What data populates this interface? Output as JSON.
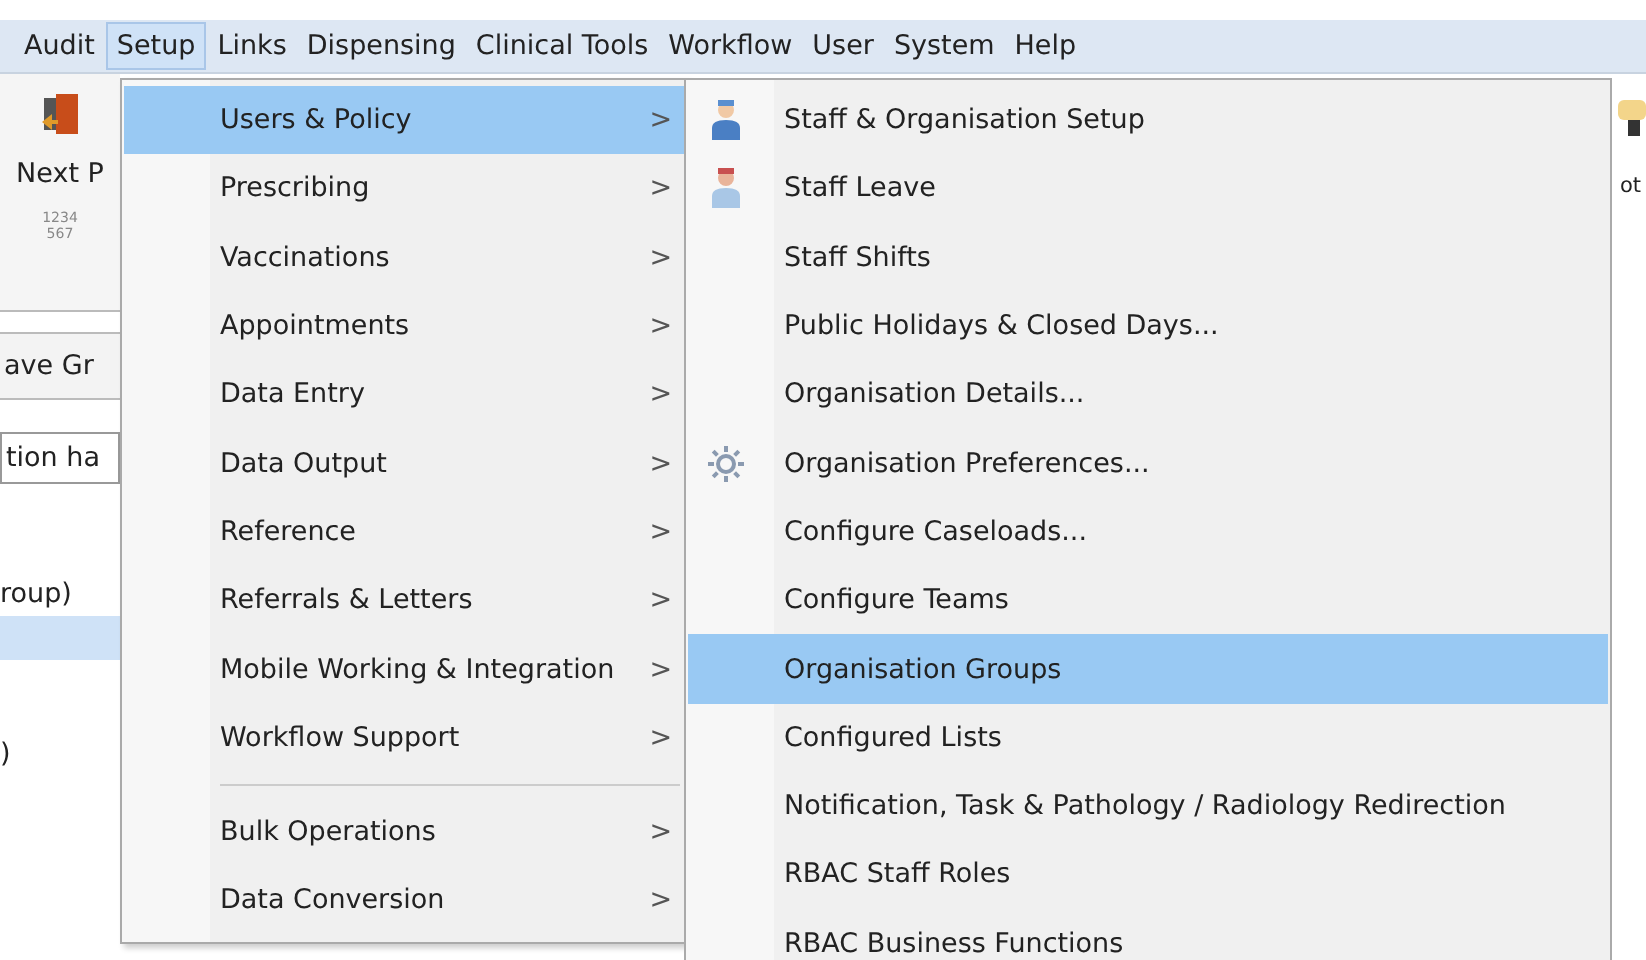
{
  "menu_bar": [
    {
      "label": "Audit",
      "selected": false
    },
    {
      "label": "Setup",
      "selected": true
    },
    {
      "label": "Links",
      "selected": false
    },
    {
      "label": "Dispensing",
      "selected": false
    },
    {
      "label": "Clinical Tools",
      "selected": false
    },
    {
      "label": "Workflow",
      "selected": false
    },
    {
      "label": "User",
      "selected": false
    },
    {
      "label": "System",
      "selected": false
    },
    {
      "label": "Help",
      "selected": false
    }
  ],
  "background": {
    "toolbar_label": "Next P",
    "numbers_icon": [
      "1234",
      "567"
    ],
    "group_label": "ave Gr",
    "field_text": "tion ha",
    "list_rows": [
      {
        "text": "roup)",
        "selected": false
      },
      {
        "text": "",
        "selected": true
      },
      {
        "text": ")",
        "selected": false
      }
    ],
    "right_label": "ot"
  },
  "setup_menu": [
    {
      "kind": "item",
      "label": "Users & Policy",
      "selected": true,
      "arrow": ">"
    },
    {
      "kind": "item",
      "label": "Prescribing",
      "selected": false,
      "arrow": ">"
    },
    {
      "kind": "item",
      "label": "Vaccinations",
      "selected": false,
      "arrow": ">"
    },
    {
      "kind": "item",
      "label": "Appointments",
      "selected": false,
      "arrow": ">"
    },
    {
      "kind": "item",
      "label": "Data Entry",
      "selected": false,
      "arrow": ">"
    },
    {
      "kind": "item",
      "label": "Data Output",
      "selected": false,
      "arrow": ">"
    },
    {
      "kind": "item",
      "label": "Reference",
      "selected": false,
      "arrow": ">"
    },
    {
      "kind": "item",
      "label": "Referrals & Letters",
      "selected": false,
      "arrow": ">"
    },
    {
      "kind": "item",
      "label": "Mobile Working & Integration",
      "selected": false,
      "arrow": ">"
    },
    {
      "kind": "item",
      "label": "Workflow Support",
      "selected": false,
      "arrow": ">"
    },
    {
      "kind": "separator"
    },
    {
      "kind": "item",
      "label": "Bulk Operations",
      "selected": false,
      "arrow": ">"
    },
    {
      "kind": "item",
      "label": "Data Conversion",
      "selected": false,
      "arrow": ">"
    }
  ],
  "submenu": [
    {
      "label": "Staff & Organisation Setup",
      "selected": false,
      "kind": "doctor"
    },
    {
      "label": "Staff Leave",
      "selected": false,
      "kind": "nurse"
    },
    {
      "label": "Staff Shifts",
      "selected": false,
      "kind": "plain"
    },
    {
      "label": "Public Holidays & Closed Days...",
      "selected": false,
      "kind": "plain"
    },
    {
      "label": "Organisation Details...",
      "selected": false,
      "kind": "plain"
    },
    {
      "label": "Organisation Preferences...",
      "selected": false,
      "kind": "gear"
    },
    {
      "label": "Configure Caseloads...",
      "selected": false,
      "kind": "plain"
    },
    {
      "label": "Configure Teams",
      "selected": false,
      "kind": "plain"
    },
    {
      "label": "Organisation Groups",
      "selected": true,
      "kind": "plain"
    },
    {
      "label": "Configured Lists",
      "selected": false,
      "kind": "plain"
    },
    {
      "label": "Notification, Task & Pathology / Radiology Redirection",
      "selected": false,
      "kind": "plain"
    },
    {
      "label": "RBAC Staff Roles",
      "selected": false,
      "kind": "plain"
    },
    {
      "label": "RBAC Business Functions",
      "selected": false,
      "kind": "plain"
    }
  ]
}
